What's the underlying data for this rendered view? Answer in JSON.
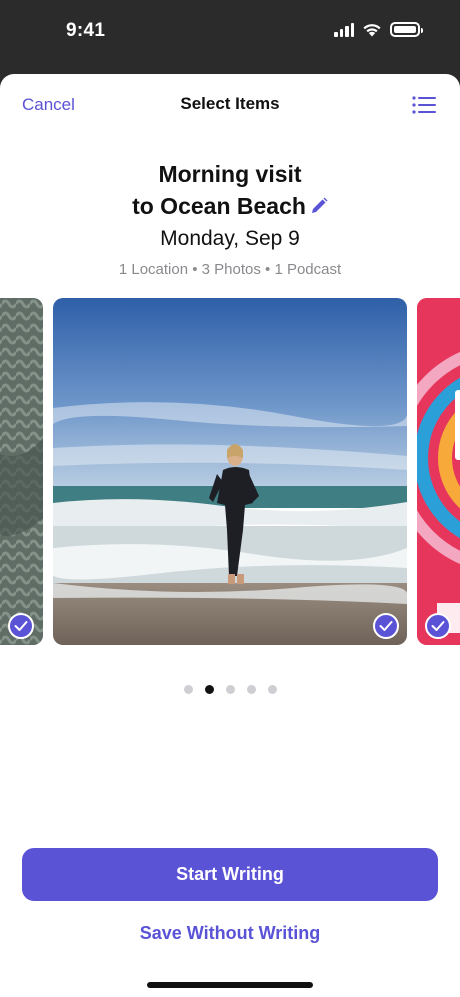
{
  "status_bar": {
    "time": "9:41"
  },
  "nav": {
    "cancel_label": "Cancel",
    "title": "Select Items",
    "list_icon": "list-icon"
  },
  "entry": {
    "title_line1": "Morning visit",
    "title_line2": "to Ocean Beach",
    "date": "Monday, Sep 9",
    "meta": "1 Location • 3 Photos • 1 Podcast"
  },
  "carousel": {
    "page_count": 5,
    "active_page": 2,
    "items": [
      {
        "kind": "photo",
        "subject": "knitted fabric",
        "selected": true
      },
      {
        "kind": "photo",
        "subject": "person in wetsuit on beach",
        "selected": true
      },
      {
        "kind": "podcast",
        "subject": "colorful artwork",
        "selected": true
      }
    ]
  },
  "actions": {
    "primary_label": "Start Writing",
    "secondary_label": "Save Without Writing"
  },
  "colors": {
    "accent": "#5b53d6",
    "text": "#111111",
    "secondary_text": "#8a8a8e"
  }
}
